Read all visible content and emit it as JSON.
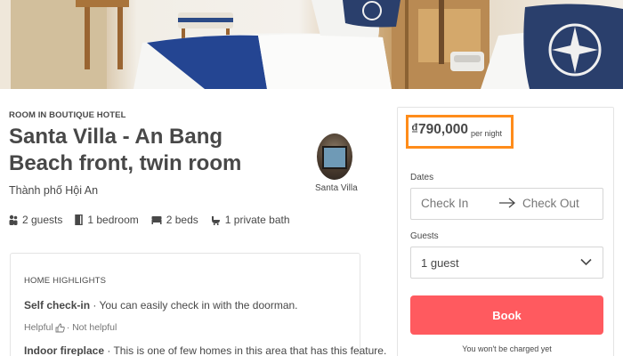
{
  "listing": {
    "room_type": "ROOM IN BOUTIQUE HOTEL",
    "title": "Santa Villa - An Bang Beach front, twin room",
    "location": "Thành phố Hội An",
    "host_name": "Santa Villa"
  },
  "amenities": [
    {
      "icon": "guests-icon",
      "label": "2 guests"
    },
    {
      "icon": "door-icon",
      "label": "1 bedroom"
    },
    {
      "icon": "bed-icon",
      "label": "2 beds"
    },
    {
      "icon": "bath-icon",
      "label": "1 private bath"
    }
  ],
  "highlights": {
    "heading": "HOME HIGHLIGHTS",
    "items": [
      {
        "title": "Self check-in",
        "text": " · You can easily check in with the doorman."
      },
      {
        "title": "Indoor fireplace",
        "text": " · This is one of few homes in this area that has this feature."
      }
    ],
    "helpful_label": "Helpful",
    "not_helpful_label": " · Not helpful"
  },
  "booking": {
    "price": "₫790,000",
    "price_unit": "per night",
    "dates_label": "Dates",
    "check_in_placeholder": "Check In",
    "check_out_placeholder": "Check Out",
    "guests_label": "Guests",
    "guests_value": "1 guest",
    "book_label": "Book",
    "no_charge_note": "You won't be charged yet",
    "colors": {
      "book_button": "#ff5a5f",
      "price_highlight": "#ff8c1a"
    }
  }
}
